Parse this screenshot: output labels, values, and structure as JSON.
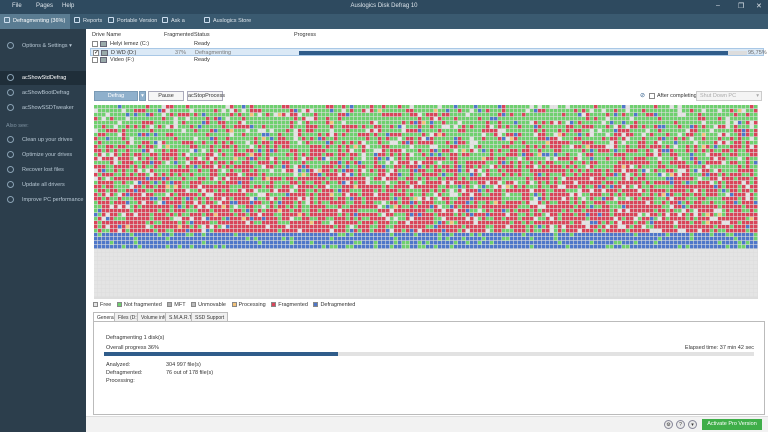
{
  "menu": [
    "File",
    "Pages",
    "Help"
  ],
  "app_title": "Auslogics Disk Defrag 10",
  "toolbar": {
    "tabs": [
      "Defragmenting (36%)",
      "Reports",
      "Portable Version",
      "Ask a Question",
      "Auslogics Store"
    ]
  },
  "sidebar": {
    "options_label": "Options & Settings",
    "items": [
      "acShowStdDefrag",
      "acShowBootDefrag",
      "acShowSSDTweaker"
    ],
    "section_label": "Also see:",
    "links": [
      "Clean up your drives",
      "Optimize your drives",
      "Recover lost files",
      "Update all drivers",
      "Improve PC performance"
    ]
  },
  "drive_list": {
    "headers": {
      "name": "Drive Name",
      "fragmented": "Fragmented",
      "status": "Status",
      "progress": "Progress"
    },
    "rows": [
      {
        "name": "Helyi lemez (C:)",
        "fragmented": "",
        "status": "Ready",
        "checked": false,
        "progress": null,
        "progress_text": ""
      },
      {
        "name": "D WD (D:)",
        "fragmented": "37%",
        "status": "Defragmenting",
        "checked": true,
        "progress": 0.9575,
        "progress_text": "95,75%"
      },
      {
        "name": "Video (F:)",
        "fragmented": "",
        "status": "Ready",
        "checked": false,
        "progress": null,
        "progress_text": ""
      }
    ]
  },
  "actions": {
    "defrag": "Defrag",
    "pause": "Pause",
    "stop": "acStopProcess",
    "after_completing": "After completing:",
    "after_value": "Shut Down PC"
  },
  "colors": {
    "free": "#e4e4e4",
    "not_fragmented": "#6fd06f",
    "mft": "#b0b0b0",
    "unmovable": "#bcbcbc",
    "processing": "#f2c27a",
    "fragmented": "#d9455a",
    "defragmented": "#4f77c9"
  },
  "legend": [
    "Free",
    "Not fragmented",
    "MFT",
    "Unmovable",
    "Processing",
    "Fragmented",
    "Defragmented"
  ],
  "info_tabs": [
    "General",
    "Files (D:)",
    "Volume info",
    "S.M.A.R.T.",
    "SSD Support"
  ],
  "general": {
    "heading": "Defragmenting 1 disk(s)",
    "overall_label": "Overall progress 36%",
    "overall_progress": 0.36,
    "elapsed": "Elapsed time: 37 min 42 sec",
    "analyzed_label": "Analyzed:",
    "analyzed_value": "304 997 file(s)",
    "defragmented_label": "Defragmented:",
    "defragmented_value": "76 out of 178 file(s)",
    "processing_label": "Processing:"
  },
  "footer": {
    "activate": "Activate Pro Version"
  }
}
